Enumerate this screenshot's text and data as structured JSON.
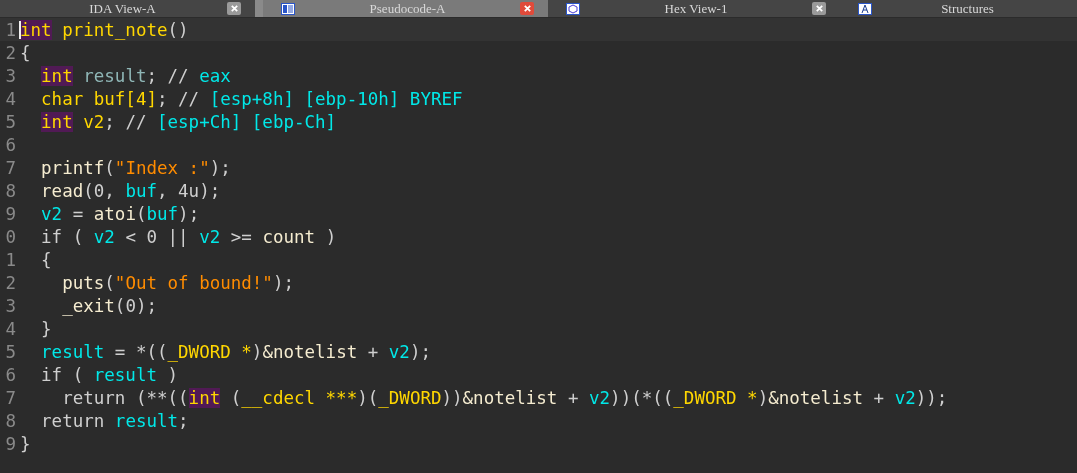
{
  "tabs": [
    {
      "label": "IDA View-A",
      "selected": false,
      "has_close": true
    },
    {
      "label": "Pseudocode-A",
      "selected": true,
      "has_close": true
    },
    {
      "label": "Hex View-1",
      "selected": false,
      "has_close": true
    },
    {
      "label": "Structures",
      "selected": false,
      "has_close": false
    }
  ],
  "code": {
    "lines": [
      {
        "number": "1",
        "current": true,
        "tokens": [
          {
            "kind": "match",
            "text": "int"
          },
          {
            "kind": "type",
            "text": " print_note"
          },
          {
            "kind": "plain",
            "text": "()"
          }
        ]
      },
      {
        "number": "2",
        "current": false,
        "tokens": [
          {
            "kind": "plain",
            "text": "{"
          }
        ]
      },
      {
        "number": "3",
        "current": false,
        "tokens": [
          {
            "kind": "match",
            "text": "  int"
          },
          {
            "kind": "decl",
            "text": " result"
          },
          {
            "kind": "plain",
            "text": "; // "
          },
          {
            "kind": "var",
            "text": "eax"
          }
        ]
      },
      {
        "number": "4",
        "current": false,
        "tokens": [
          {
            "kind": "type",
            "text": "  char buf[4]"
          },
          {
            "kind": "plain",
            "text": "; // "
          },
          {
            "kind": "var",
            "text": "[esp+8h] [ebp-10h] BYREF"
          }
        ]
      },
      {
        "number": "5",
        "current": false,
        "tokens": [
          {
            "kind": "match",
            "text": "  int"
          },
          {
            "kind": "type",
            "text": " v2"
          },
          {
            "kind": "plain",
            "text": "; // "
          },
          {
            "kind": "var",
            "text": "[esp+Ch] [ebp-Ch]"
          }
        ]
      },
      {
        "number": "6",
        "current": false
      },
      {
        "number": "7",
        "current": false,
        "tokens": [
          {
            "kind": "func",
            "text": "  printf"
          },
          {
            "kind": "plain",
            "text": "("
          },
          {
            "kind": "str",
            "text": "\"Index :\""
          },
          {
            "kind": "plain",
            "text": ");"
          }
        ]
      },
      {
        "number": "8",
        "current": false,
        "tokens": [
          {
            "kind": "func",
            "text": "  read"
          },
          {
            "kind": "plain",
            "text": "(0, "
          },
          {
            "kind": "var",
            "text": "buf"
          },
          {
            "kind": "plain",
            "text": ", 4u);"
          }
        ]
      },
      {
        "number": "9",
        "current": false,
        "tokens": [
          {
            "kind": "var",
            "text": "  v2"
          },
          {
            "kind": "plain",
            "text": " = "
          },
          {
            "kind": "func",
            "text": "atoi"
          },
          {
            "kind": "plain",
            "text": "("
          },
          {
            "kind": "var",
            "text": "buf"
          },
          {
            "kind": "plain",
            "text": ");"
          }
        ]
      },
      {
        "number": "0",
        "current": false,
        "tokens": [
          {
            "kind": "plain",
            "text": "  if ( "
          },
          {
            "kind": "var",
            "text": "v2"
          },
          {
            "kind": "plain",
            "text": " < 0 || "
          },
          {
            "kind": "var",
            "text": "v2"
          },
          {
            "kind": "plain",
            "text": " >= "
          },
          {
            "kind": "func",
            "text": "count"
          },
          {
            "kind": "plain",
            "text": " )"
          }
        ]
      },
      {
        "number": "1",
        "current": false,
        "tokens": [
          {
            "kind": "plain",
            "text": "  {"
          }
        ]
      },
      {
        "number": "2",
        "current": false,
        "tokens": [
          {
            "kind": "func",
            "text": "    puts"
          },
          {
            "kind": "plain",
            "text": "("
          },
          {
            "kind": "str",
            "text": "\"Out of bound!\""
          },
          {
            "kind": "plain",
            "text": ");"
          }
        ]
      },
      {
        "number": "3",
        "current": false,
        "tokens": [
          {
            "kind": "func",
            "text": "    _exit"
          },
          {
            "kind": "plain",
            "text": "(0);"
          }
        ]
      },
      {
        "number": "4",
        "current": false,
        "tokens": [
          {
            "kind": "plain",
            "text": "  }"
          }
        ]
      },
      {
        "number": "5",
        "current": false,
        "tokens": [
          {
            "kind": "var",
            "text": "  result"
          },
          {
            "kind": "plain",
            "text": " = *(("
          },
          {
            "kind": "type",
            "text": "_DWORD *"
          },
          {
            "kind": "plain",
            "text": ")"
          },
          {
            "kind": "func",
            "text": "&notelist"
          },
          {
            "kind": "plain",
            "text": " + "
          },
          {
            "kind": "var",
            "text": "v2"
          },
          {
            "kind": "plain",
            "text": ");"
          }
        ]
      },
      {
        "number": "6",
        "current": false,
        "tokens": [
          {
            "kind": "plain",
            "text": "  if ( "
          },
          {
            "kind": "var",
            "text": "result"
          },
          {
            "kind": "plain",
            "text": " )"
          }
        ]
      },
      {
        "number": "7",
        "current": false,
        "tokens": [
          {
            "kind": "plain",
            "text": "    return (**(("
          },
          {
            "kind": "match",
            "text": "int"
          },
          {
            "kind": "plain",
            "text": " ("
          },
          {
            "kind": "type",
            "text": "__cdecl ***"
          },
          {
            "kind": "plain",
            "text": ")("
          },
          {
            "kind": "type",
            "text": "_DWORD"
          },
          {
            "kind": "plain",
            "text": "))"
          },
          {
            "kind": "func",
            "text": "&notelist"
          },
          {
            "kind": "plain",
            "text": " + "
          },
          {
            "kind": "var",
            "text": "v2"
          },
          {
            "kind": "plain",
            "text": "))(*(("
          },
          {
            "kind": "type",
            "text": "_DWORD *"
          },
          {
            "kind": "plain",
            "text": ")"
          },
          {
            "kind": "func",
            "text": "&notelist"
          },
          {
            "kind": "plain",
            "text": " + "
          },
          {
            "kind": "var",
            "text": "v2"
          },
          {
            "kind": "plain",
            "text": "));"
          }
        ]
      },
      {
        "number": "8",
        "current": false,
        "tokens": [
          {
            "kind": "plain",
            "text": "  return "
          },
          {
            "kind": "var",
            "text": "result"
          },
          {
            "kind": "plain",
            "text": ";"
          }
        ]
      },
      {
        "number": "9",
        "current": false,
        "tokens": [
          {
            "kind": "plain",
            "text": "}"
          }
        ]
      }
    ]
  }
}
